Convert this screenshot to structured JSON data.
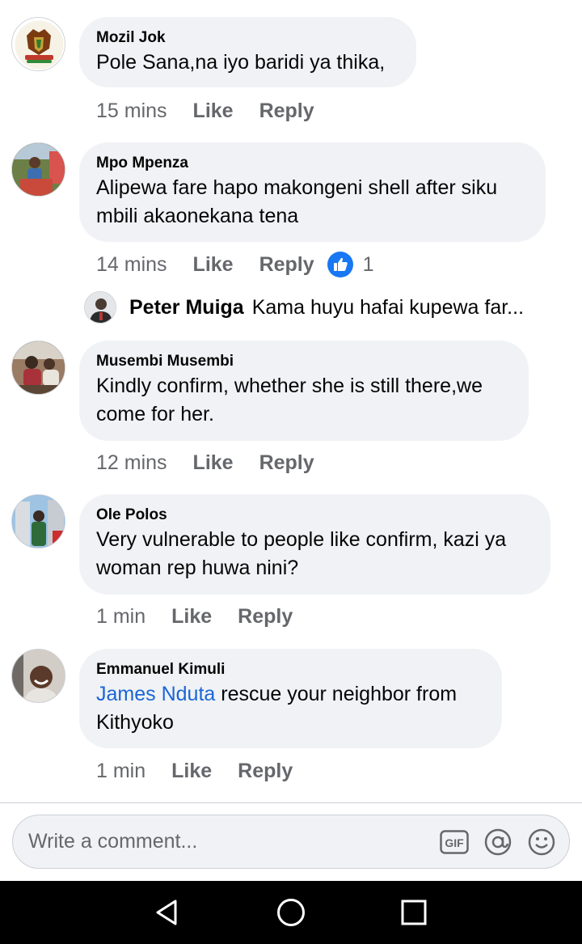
{
  "comments": [
    {
      "author": "Mozil Jok",
      "text": "Pole Sana,na iyo baridi ya thika,",
      "time": "15 mins",
      "like_label": "Like",
      "reply_label": "Reply"
    },
    {
      "author": "Mpo Mpenza",
      "text": "Alipewa fare hapo makongeni shell after siku mbili akaonekana tena",
      "time": "14 mins",
      "like_label": "Like",
      "reply_label": "Reply",
      "reaction_count": "1"
    },
    {
      "author": "Musembi Musembi",
      "text": "Kindly confirm, whether she is still there,we come for her.",
      "time": "12 mins",
      "like_label": "Like",
      "reply_label": "Reply"
    },
    {
      "author": "Ole Polos",
      "text": "Very vulnerable to people like confirm, kazi ya woman rep huwa nini?",
      "time": "1 min",
      "like_label": "Like",
      "reply_label": "Reply"
    },
    {
      "author": "Emmanuel Kimuli",
      "mention": "James Nduta",
      "text": " rescue your neighbor from Kithyoko",
      "time": "1 min",
      "like_label": "Like",
      "reply_label": "Reply"
    }
  ],
  "reply_preview": {
    "author": "Peter Muiga",
    "text": "Kama huyu hafai kupewa far..."
  },
  "composer": {
    "placeholder": "Write a comment..."
  },
  "colors": {
    "bubble": "#f0f2f5",
    "meta_text": "#65676b",
    "mention": "#1a66d6",
    "like_badge": "#1877f2",
    "nav_bar": "#000000"
  },
  "icons": [
    "gif-icon",
    "mention-at-icon",
    "emoji-icon",
    "thumbs-up-icon",
    "back-triangle-icon",
    "home-circle-icon",
    "recents-square-icon"
  ]
}
